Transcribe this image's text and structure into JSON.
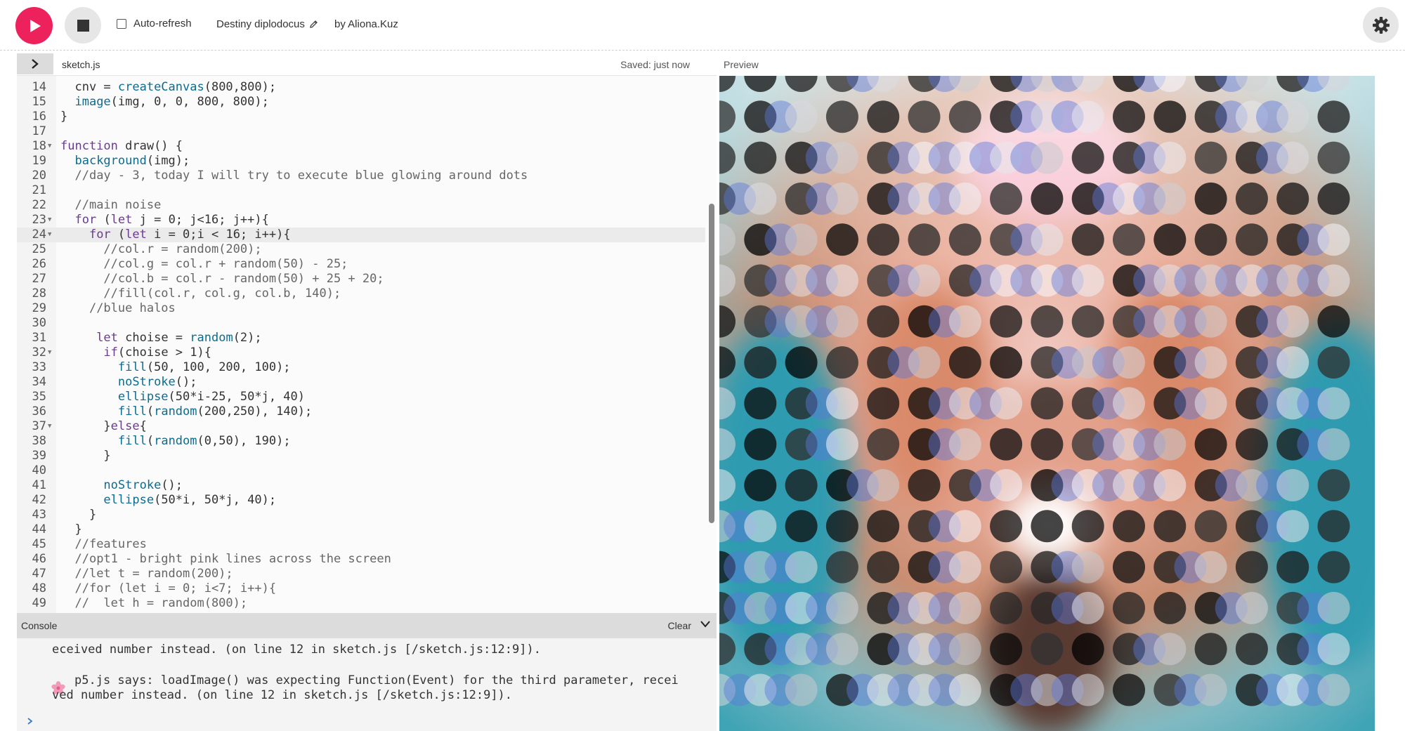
{
  "toolbar": {
    "play_icon": "play-icon",
    "stop_icon": "stop-icon",
    "auto_refresh_label": "Auto-refresh",
    "auto_refresh_checked": false,
    "sketch_name": "Destiny diplodocus",
    "pencil_icon": "pencil-icon",
    "author": "by Aliona.Kuz",
    "settings_icon": "gear-icon"
  },
  "editor": {
    "file_name": "sketch.js",
    "saved_status": "Saved: just now",
    "collapse_icon": "chevron-right-icon",
    "lines": [
      {
        "n": "14",
        "text": "  cnv = createCanvas(800,800);"
      },
      {
        "n": "15",
        "text": "  image(img, 0, 0, 800, 800);"
      },
      {
        "n": "16",
        "text": "}"
      },
      {
        "n": "17",
        "text": ""
      },
      {
        "n": "18",
        "text": "function draw() {",
        "fold": true
      },
      {
        "n": "19",
        "text": "  background(img);"
      },
      {
        "n": "20",
        "text": "  //day - 3, today I will try to execute blue glowing around dots"
      },
      {
        "n": "21",
        "text": ""
      },
      {
        "n": "22",
        "text": "  //main noise"
      },
      {
        "n": "23",
        "text": "  for (let j = 0; j<16; j++){",
        "fold": true
      },
      {
        "n": "24",
        "text": "    for (let i = 0;i < 16; i++){",
        "fold": true,
        "active": true
      },
      {
        "n": "25",
        "text": "      //col.r = random(200);"
      },
      {
        "n": "26",
        "text": "      //col.g = col.r + random(50) - 25;"
      },
      {
        "n": "27",
        "text": "      //col.b = col.r - random(50) + 25 + 20;"
      },
      {
        "n": "28",
        "text": "      //fill(col.r, col.g, col.b, 140);"
      },
      {
        "n": "29",
        "text": "    //blue halos"
      },
      {
        "n": "30",
        "text": ""
      },
      {
        "n": "31",
        "text": "     let choise = random(2);"
      },
      {
        "n": "32",
        "text": "      if(choise > 1){",
        "fold": true
      },
      {
        "n": "33",
        "text": "        fill(50, 100, 200, 100);"
      },
      {
        "n": "34",
        "text": "        noStroke();"
      },
      {
        "n": "35",
        "text": "        ellipse(50*i-25, 50*j, 40)"
      },
      {
        "n": "36",
        "text": "        fill(random(200,250), 140);"
      },
      {
        "n": "37",
        "text": "      }else{",
        "fold": true
      },
      {
        "n": "38",
        "text": "        fill(random(0,50), 190);"
      },
      {
        "n": "39",
        "text": "      }"
      },
      {
        "n": "40",
        "text": ""
      },
      {
        "n": "41",
        "text": "      noStroke();"
      },
      {
        "n": "42",
        "text": "      ellipse(50*i, 50*j, 40);"
      },
      {
        "n": "43",
        "text": "    }"
      },
      {
        "n": "44",
        "text": "  }"
      },
      {
        "n": "45",
        "text": "  //features"
      },
      {
        "n": "46",
        "text": "  //opt1 - bright pink lines across the screen"
      },
      {
        "n": "47",
        "text": "  //let t = random(200);"
      },
      {
        "n": "48",
        "text": "  //for (let i = 0; i<7; i++){"
      },
      {
        "n": "49",
        "text": "  //  let h = random(800);"
      }
    ]
  },
  "console": {
    "title": "Console",
    "clear_label": "Clear",
    "chevron_icon": "chevron-down-icon",
    "messages": [
      "eceived number instead. (on line 12 in sketch.js [/sketch.js:12:9]).",
      "p5.js says: loadImage() was expecting Function(Event) for the third parameter, recei",
      "ved number instead. (on line 12 in sketch.js [/sketch.js:12:9])."
    ],
    "prompt_icon": "chevron-right-icon"
  },
  "preview": {
    "label": "Preview"
  },
  "colors": {
    "accent": "#ed225d",
    "button_gray": "#e6e6e6",
    "console_header": "#dcdcdc"
  }
}
